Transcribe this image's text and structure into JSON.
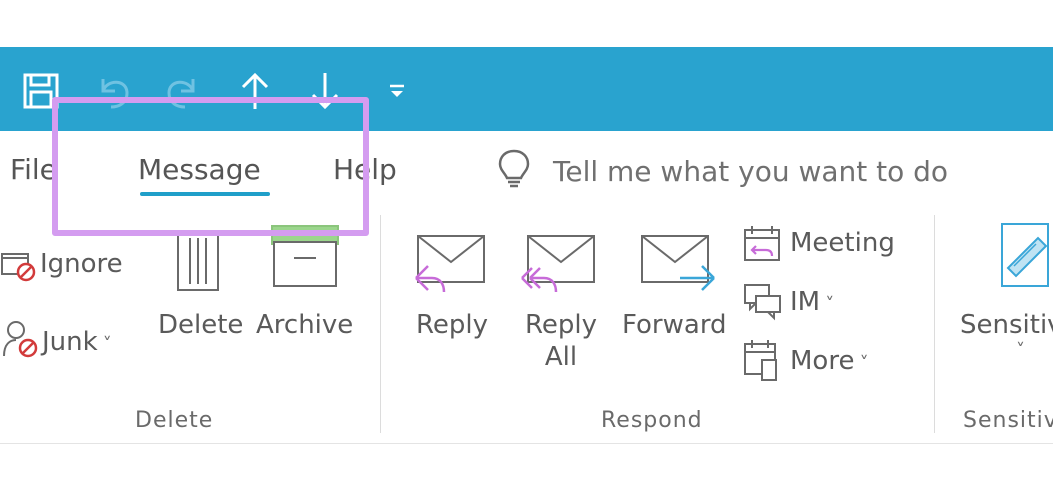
{
  "tabs": {
    "file": "File",
    "message": "Message",
    "help": "Help"
  },
  "tell_me": {
    "text": "Tell me what you want to do"
  },
  "ribbon": {
    "delete_group": {
      "label": "Delete",
      "ignore": "Ignore",
      "junk": "Junk",
      "junk_arrow": "˅",
      "delete": "Delete",
      "archive": "Archive"
    },
    "respond_group": {
      "label": "Respond",
      "reply": "Reply",
      "reply_all_line1": "Reply",
      "reply_all_line2": "All",
      "forward": "Forward",
      "meeting": "Meeting",
      "im": "IM",
      "im_arrow": "˅",
      "more": "More",
      "more_arrow": "˅"
    },
    "sensitivity_group": {
      "label": "Sensitiv",
      "button": "Sensitiv",
      "arrow": "˅"
    }
  },
  "icons": {
    "quick_access": [
      "save-icon",
      "undo-icon",
      "redo-icon",
      "up-arrow-icon",
      "down-arrow-icon",
      "customize-toolbar-icon"
    ],
    "tell_me": "lightbulb-icon"
  },
  "colors": {
    "title_bar": "#29a3cf",
    "tab_underline": "#1f9fc9",
    "highlight": "#d49cf0",
    "reply_arrow": "#c76bd8",
    "forward_arrow": "#3aa6d8",
    "junk_icon": "#d23b3b"
  }
}
